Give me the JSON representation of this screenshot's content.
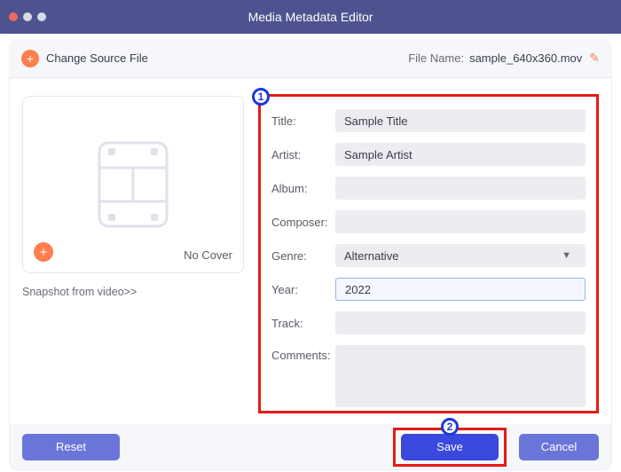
{
  "window": {
    "title": "Media Metadata Editor"
  },
  "toolbar": {
    "change_source": "Change Source File",
    "file_name_label": "File Name:",
    "file_name_value": "sample_640x360.mov"
  },
  "cover": {
    "no_cover": "No Cover",
    "snapshot": "Snapshot from video>>"
  },
  "labels": {
    "title": "Title:",
    "artist": "Artist:",
    "album": "Album:",
    "composer": "Composer:",
    "genre": "Genre:",
    "year": "Year:",
    "track": "Track:",
    "comments": "Comments:"
  },
  "values": {
    "title": "Sample Title",
    "artist": "Sample Artist",
    "album": "",
    "composer": "",
    "genre": "Alternative",
    "year": "2022",
    "track": "",
    "comments": ""
  },
  "buttons": {
    "reset": "Reset",
    "save": "Save",
    "cancel": "Cancel"
  },
  "callouts": {
    "one": "1",
    "two": "2"
  }
}
